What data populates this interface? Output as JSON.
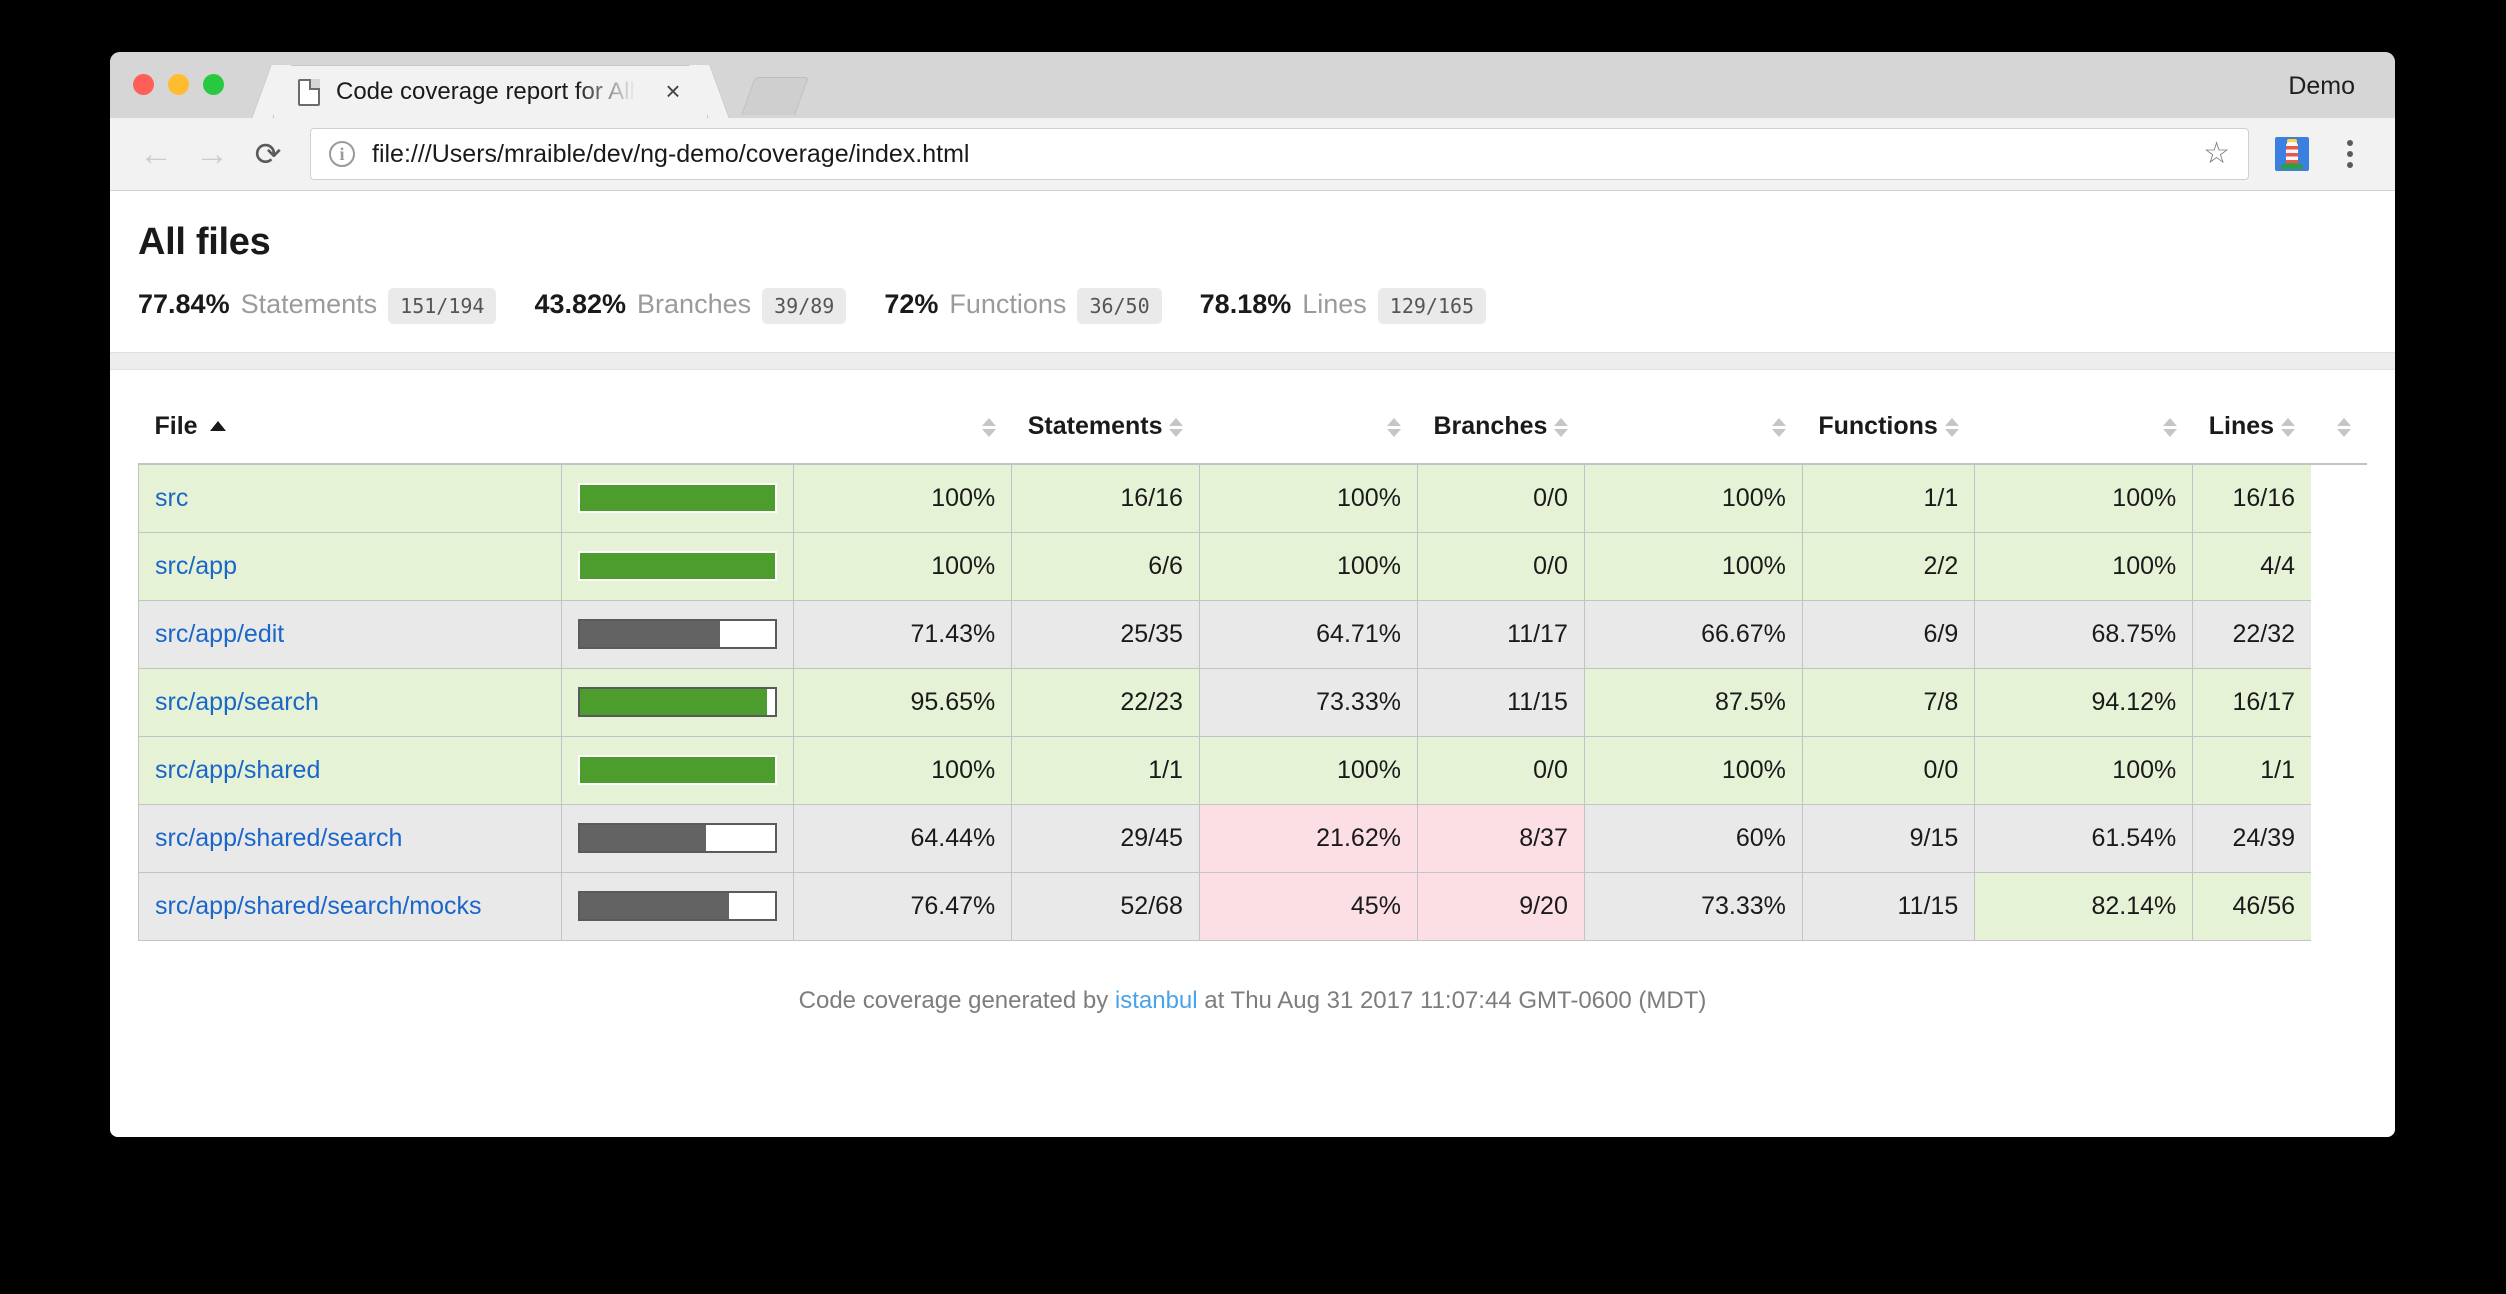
{
  "browser": {
    "profile_name": "Demo",
    "tab": {
      "title": "Code coverage report for All files",
      "favicon": "document-icon",
      "close_label": "×"
    },
    "new_tab_label": "",
    "nav": {
      "back": "←",
      "forward": "→",
      "reload": "⟳"
    },
    "omnibox": {
      "url": "file:///Users/mraible/dev/ng-demo/coverage/index.html",
      "info_icon": "info-icon",
      "star_icon": "bookmark-star-icon"
    },
    "extension_icon": "lighthouse-extension-icon",
    "menu_icon": "three-dot-menu-icon"
  },
  "report": {
    "title": "All files",
    "summary": [
      {
        "pct": "77.84%",
        "label": "Statements",
        "fraction": "151/194"
      },
      {
        "pct": "43.82%",
        "label": "Branches",
        "fraction": "39/89"
      },
      {
        "pct": "72%",
        "label": "Functions",
        "fraction": "36/50"
      },
      {
        "pct": "78.18%",
        "label": "Lines",
        "fraction": "129/165"
      }
    ],
    "table": {
      "headers": {
        "file": "File",
        "statements": "Statements",
        "branches": "Branches",
        "functions": "Functions",
        "lines": "Lines"
      },
      "sort": {
        "column": "File",
        "direction": "asc",
        "indicator": "▲"
      },
      "rows": [
        {
          "file": "src",
          "bar": {
            "pct": 100,
            "level": "high"
          },
          "statements": {
            "pct": "100%",
            "abs": "16/16",
            "level": "high"
          },
          "branches": {
            "pct": "100%",
            "abs": "0/0",
            "level": "high"
          },
          "functions": {
            "pct": "100%",
            "abs": "1/1",
            "level": "high"
          },
          "lines": {
            "pct": "100%",
            "abs": "16/16",
            "level": "high"
          }
        },
        {
          "file": "src/app",
          "bar": {
            "pct": 100,
            "level": "high"
          },
          "statements": {
            "pct": "100%",
            "abs": "6/6",
            "level": "high"
          },
          "branches": {
            "pct": "100%",
            "abs": "0/0",
            "level": "high"
          },
          "functions": {
            "pct": "100%",
            "abs": "2/2",
            "level": "high"
          },
          "lines": {
            "pct": "100%",
            "abs": "4/4",
            "level": "high"
          }
        },
        {
          "file": "src/app/edit",
          "bar": {
            "pct": 71.43,
            "level": "medium"
          },
          "statements": {
            "pct": "71.43%",
            "abs": "25/35",
            "level": "medium"
          },
          "branches": {
            "pct": "64.71%",
            "abs": "11/17",
            "level": "medium"
          },
          "functions": {
            "pct": "66.67%",
            "abs": "6/9",
            "level": "medium"
          },
          "lines": {
            "pct": "68.75%",
            "abs": "22/32",
            "level": "medium"
          }
        },
        {
          "file": "src/app/search",
          "bar": {
            "pct": 95.65,
            "level": "high"
          },
          "statements": {
            "pct": "95.65%",
            "abs": "22/23",
            "level": "high"
          },
          "branches": {
            "pct": "73.33%",
            "abs": "11/15",
            "level": "medium"
          },
          "functions": {
            "pct": "87.5%",
            "abs": "7/8",
            "level": "high"
          },
          "lines": {
            "pct": "94.12%",
            "abs": "16/17",
            "level": "high"
          }
        },
        {
          "file": "src/app/shared",
          "bar": {
            "pct": 100,
            "level": "high"
          },
          "statements": {
            "pct": "100%",
            "abs": "1/1",
            "level": "high"
          },
          "branches": {
            "pct": "100%",
            "abs": "0/0",
            "level": "high"
          },
          "functions": {
            "pct": "100%",
            "abs": "0/0",
            "level": "high"
          },
          "lines": {
            "pct": "100%",
            "abs": "1/1",
            "level": "high"
          }
        },
        {
          "file": "src/app/shared/search",
          "bar": {
            "pct": 64.44,
            "level": "medium"
          },
          "statements": {
            "pct": "64.44%",
            "abs": "29/45",
            "level": "medium"
          },
          "branches": {
            "pct": "21.62%",
            "abs": "8/37",
            "level": "low"
          },
          "functions": {
            "pct": "60%",
            "abs": "9/15",
            "level": "medium"
          },
          "lines": {
            "pct": "61.54%",
            "abs": "24/39",
            "level": "medium"
          }
        },
        {
          "file": "src/app/shared/search/mocks",
          "bar": {
            "pct": 76.47,
            "level": "medium"
          },
          "statements": {
            "pct": "76.47%",
            "abs": "52/68",
            "level": "medium"
          },
          "branches": {
            "pct": "45%",
            "abs": "9/20",
            "level": "low"
          },
          "functions": {
            "pct": "73.33%",
            "abs": "11/15",
            "level": "medium"
          },
          "lines": {
            "pct": "82.14%",
            "abs": "46/56",
            "level": "high"
          }
        }
      ]
    },
    "footer": {
      "prefix": "Code coverage generated by ",
      "link": "istanbul",
      "suffix": " at Thu Aug 31 2017 11:07:44 GMT-0600 (MDT)"
    }
  },
  "colors": {
    "high_bg": "#e6f2d6",
    "medium_bg": "#e9e9e9",
    "low_bg": "#fcdfe4",
    "high_bar": "#4c9c2e",
    "medium_bar": "#636363",
    "link": "#1a66c9"
  }
}
